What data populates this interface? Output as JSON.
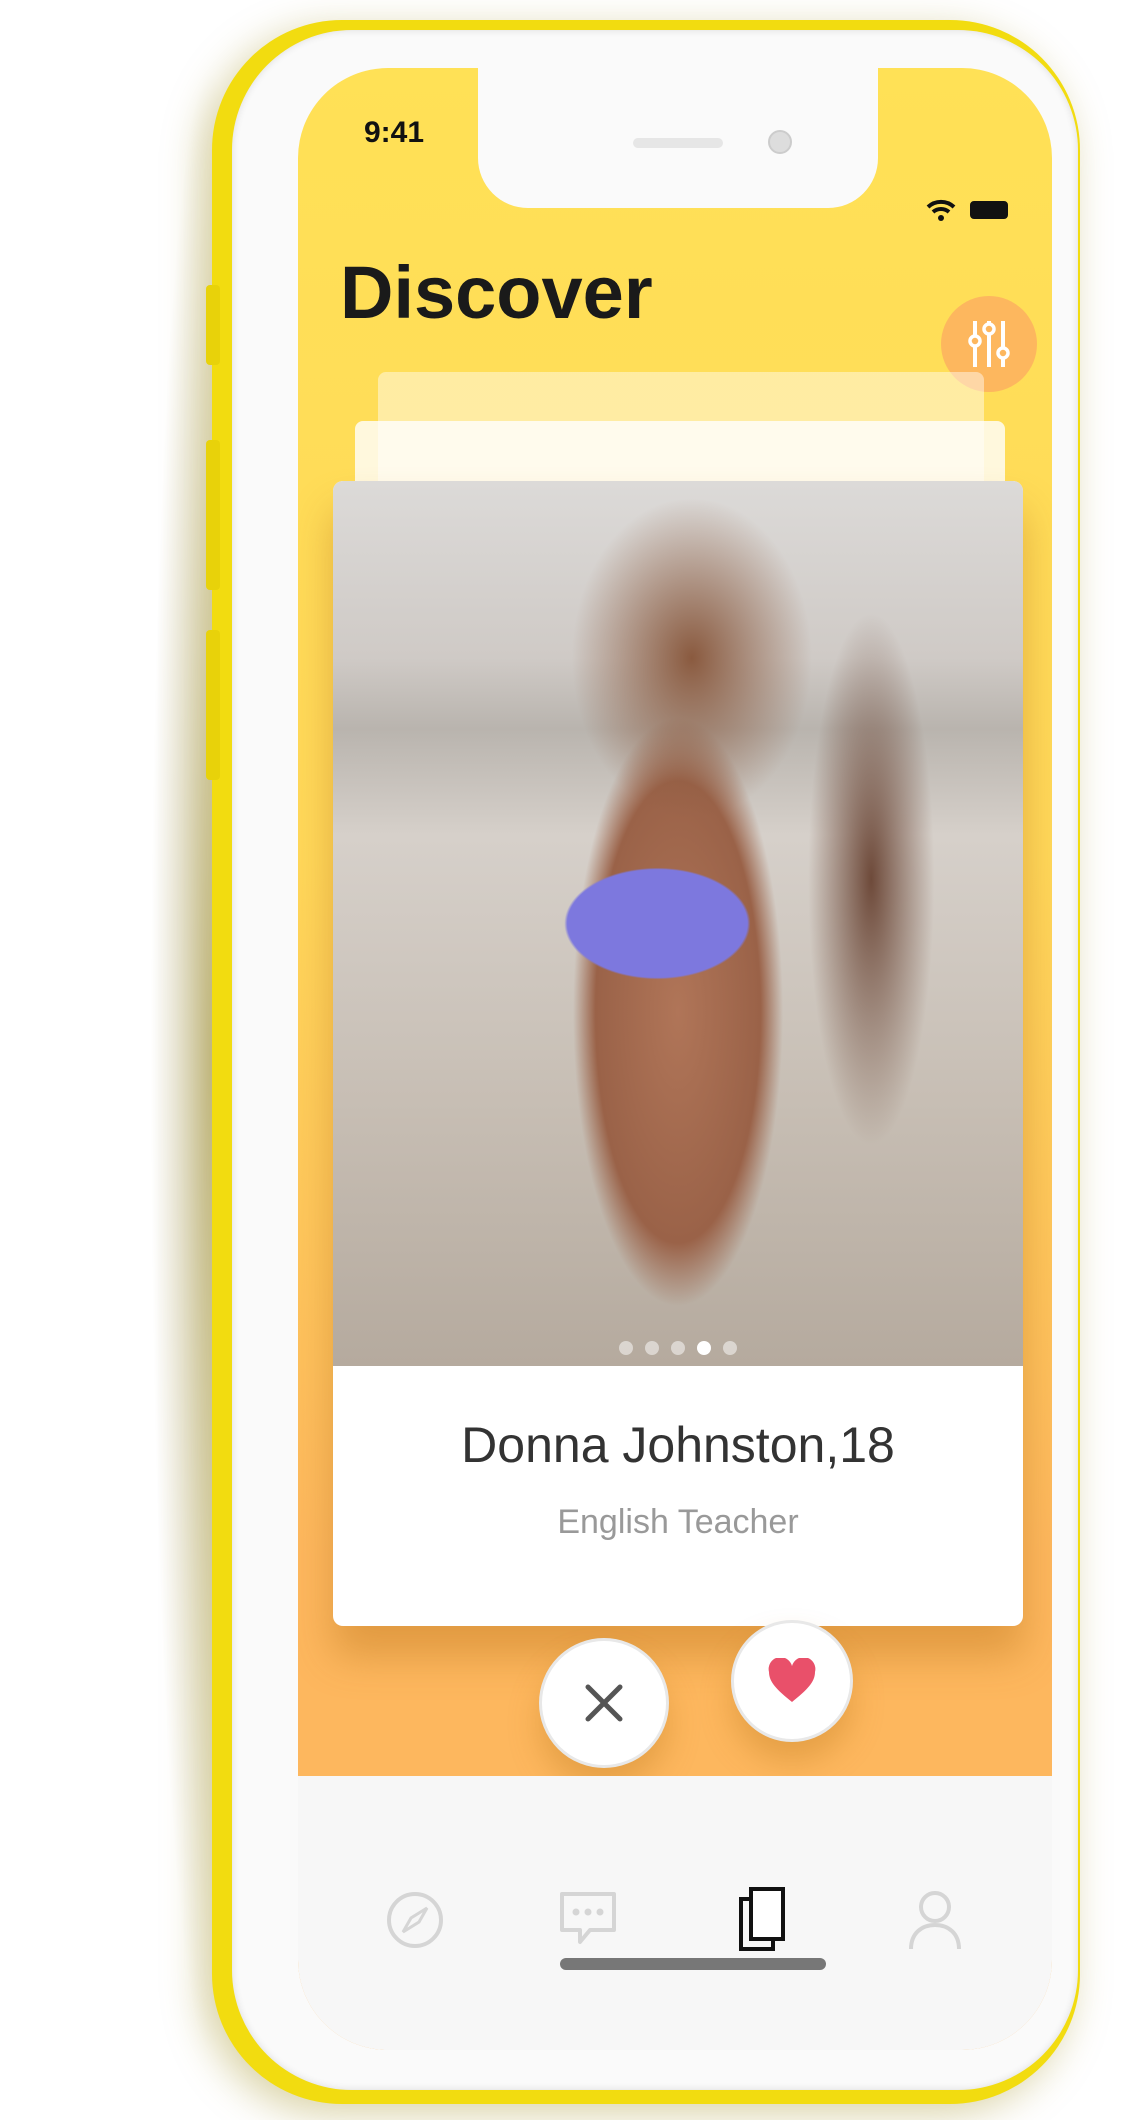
{
  "status_bar": {
    "time": "9:41"
  },
  "header": {
    "title": "Discover",
    "filter_icon": "sliders-icon"
  },
  "profile_card": {
    "name": "Donna Johnston,18",
    "occupation": "English Teacher",
    "photo_count": 5,
    "active_photo_index": 3
  },
  "actions": {
    "dislike_icon": "close-icon",
    "like_icon": "heart-icon",
    "like_color": "#e9506a"
  },
  "tabbar": {
    "items": [
      {
        "name": "discover",
        "icon": "compass-icon",
        "active": false
      },
      {
        "name": "messages",
        "icon": "chat-icon",
        "active": false
      },
      {
        "name": "cards",
        "icon": "cards-icon",
        "active": true
      },
      {
        "name": "profile",
        "icon": "user-icon",
        "active": false
      }
    ]
  },
  "colors": {
    "accent": "#ffe156",
    "accent_dark": "#fdb75e",
    "phone_frame": "#f2dc10"
  }
}
